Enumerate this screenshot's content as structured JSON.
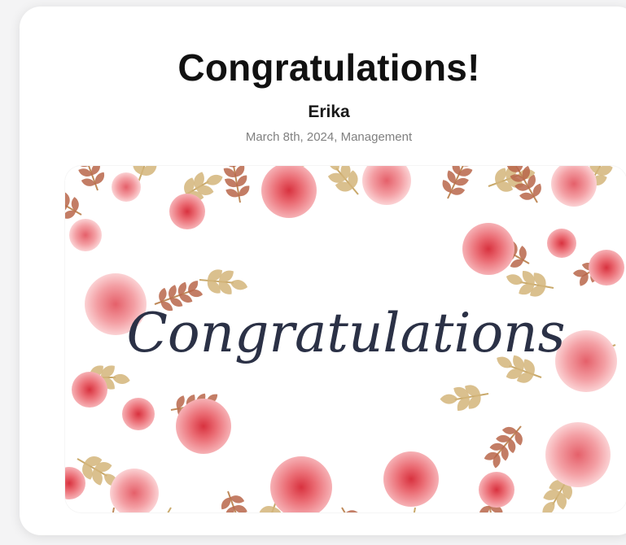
{
  "card": {
    "title": "Congratulations!",
    "recipient": "Erika",
    "meta": "March 8th, 2024, Management"
  },
  "image": {
    "script_text": "Congratulations",
    "colors": {
      "rose": "#e8646f",
      "rose_light": "#f3a3a8",
      "leaf_gold": "#c9a96b",
      "leaf_rust": "#b8664a",
      "ink": "#2b3146"
    }
  }
}
